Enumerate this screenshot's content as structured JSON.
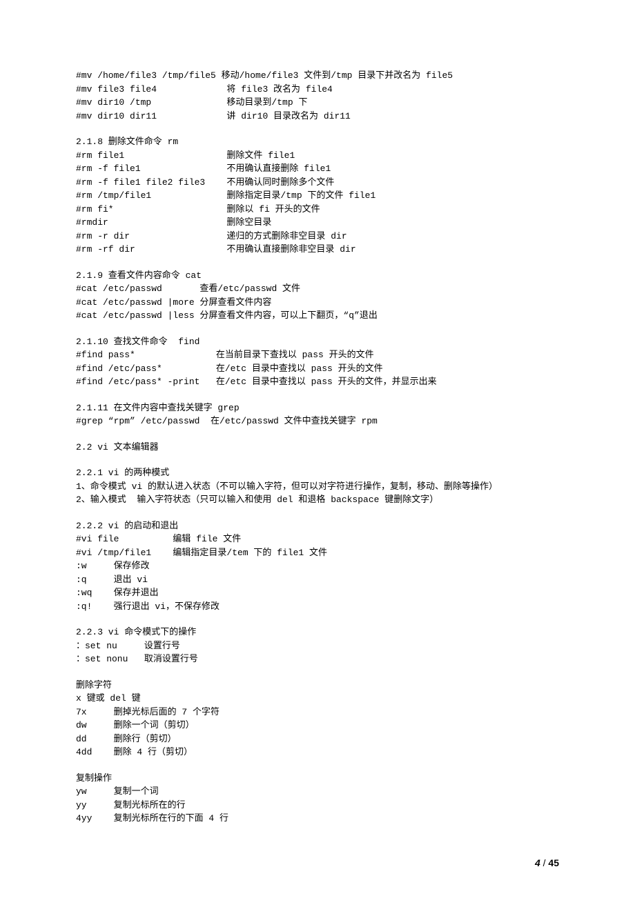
{
  "blocks": [
    {
      "type": "line",
      "text": "#mv /home/file3 /tmp/file5 移动/home/file3 文件到/tmp 目录下并改名为 file5"
    },
    {
      "type": "line",
      "text": "#mv file3 file4             将 file3 改名为 file4"
    },
    {
      "type": "line",
      "text": "#mv dir10 /tmp              移动目录到/tmp 下"
    },
    {
      "type": "line",
      "text": "#mv dir10 dir11             讲 dir10 目录改名为 dir11"
    },
    {
      "type": "blank"
    },
    {
      "type": "line",
      "text": "2.1.8 删除文件命令 rm"
    },
    {
      "type": "line",
      "text": "#rm file1                   删除文件 file1"
    },
    {
      "type": "line",
      "text": "#rm -f file1                不用确认直接删除 file1"
    },
    {
      "type": "line",
      "text": "#rm -f file1 file2 file3    不用确认同时删除多个文件"
    },
    {
      "type": "line",
      "text": "#rm /tmp/file1              删除指定目录/tmp 下的文件 file1"
    },
    {
      "type": "line",
      "text": "#rm fi*                     删除以 fi 开头的文件"
    },
    {
      "type": "line",
      "text": "#rmdir                      删除空目录"
    },
    {
      "type": "line",
      "text": "#rm -r dir                  递归的方式删除非空目录 dir"
    },
    {
      "type": "line",
      "text": "#rm -rf dir                 不用确认直接删除非空目录 dir"
    },
    {
      "type": "blank"
    },
    {
      "type": "line",
      "text": "2.1.9 查看文件内容命令 cat"
    },
    {
      "type": "line",
      "text": "#cat /etc/passwd       查看/etc/passwd 文件"
    },
    {
      "type": "line",
      "text": "#cat /etc/passwd |more 分屏查看文件内容"
    },
    {
      "type": "line",
      "text": "#cat /etc/passwd |less 分屏查看文件内容，可以上下翻页，“q”退出"
    },
    {
      "type": "blank"
    },
    {
      "type": "line",
      "text": "2.1.10 查找文件命令  find"
    },
    {
      "type": "line",
      "text": "#find pass*               在当前目录下查找以 pass 开头的文件"
    },
    {
      "type": "line",
      "text": "#find /etc/pass*          在/etc 目录中查找以 pass 开头的文件"
    },
    {
      "type": "line",
      "text": "#find /etc/pass* -print   在/etc 目录中查找以 pass 开头的文件，并显示出来"
    },
    {
      "type": "blank"
    },
    {
      "type": "line",
      "text": "2.1.11 在文件内容中查找关键字 grep"
    },
    {
      "type": "line",
      "text": "#grep “rpm” /etc/passwd  在/etc/passwd 文件中查找关键字 rpm"
    },
    {
      "type": "blank"
    },
    {
      "type": "line",
      "text": "2.2 vi 文本编辑器"
    },
    {
      "type": "blank"
    },
    {
      "type": "line",
      "text": "2.2.1 vi 的两种模式"
    },
    {
      "type": "line",
      "text": "1、命令模式 vi 的默认进入状态（不可以输入字符，但可以对字符进行操作，复制，移动、删除等操作）"
    },
    {
      "type": "line",
      "text": "2、输入模式  输入字符状态（只可以输入和使用 del 和退格 backspace 键删除文字）"
    },
    {
      "type": "blank"
    },
    {
      "type": "line",
      "text": "2.2.2 vi 的启动和退出"
    },
    {
      "type": "line",
      "text": "#vi file          编辑 file 文件"
    },
    {
      "type": "line",
      "text": "#vi /tmp/file1    编辑指定目录/tem 下的 file1 文件"
    },
    {
      "type": "line",
      "text": ":w     保存修改"
    },
    {
      "type": "line",
      "text": ":q     退出 vi"
    },
    {
      "type": "line",
      "text": ":wq    保存并退出"
    },
    {
      "type": "line",
      "text": ":q!    强行退出 vi，不保存修改"
    },
    {
      "type": "blank"
    },
    {
      "type": "line",
      "text": "2.2.3 vi 命令模式下的操作"
    },
    {
      "type": "line",
      "text": "：set nu     设置行号"
    },
    {
      "type": "line",
      "text": "：set nonu   取消设置行号"
    },
    {
      "type": "blank"
    },
    {
      "type": "line",
      "text": "删除字符"
    },
    {
      "type": "line",
      "text": "x 键或 del 键"
    },
    {
      "type": "line",
      "text": "7x     删掉光标后面的 7 个字符"
    },
    {
      "type": "line",
      "text": "dw     删除一个词（剪切）"
    },
    {
      "type": "line",
      "text": "dd     删除行（剪切）"
    },
    {
      "type": "line",
      "text": "4dd    删除 4 行（剪切）"
    },
    {
      "type": "blank"
    },
    {
      "type": "line",
      "text": "复制操作"
    },
    {
      "type": "line",
      "text": "yw     复制一个词"
    },
    {
      "type": "line",
      "text": "yy     复制光标所在的行"
    },
    {
      "type": "line",
      "text": "4yy    复制光标所在行的下面 4 行"
    }
  ],
  "page": {
    "current": "4",
    "total": "45",
    "sep": " / "
  }
}
